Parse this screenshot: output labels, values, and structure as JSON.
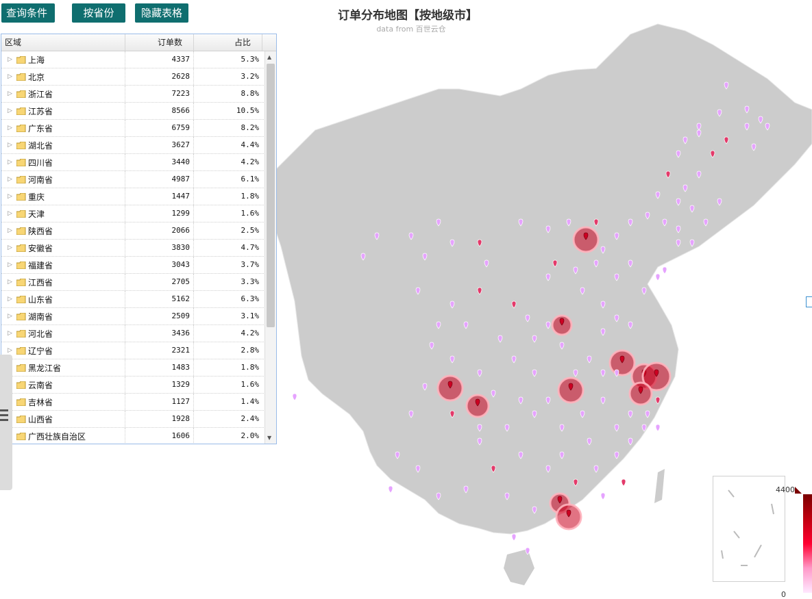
{
  "toolbar": {
    "query_label": "查询条件",
    "province_label": "按省份",
    "hide_label": "隐藏表格"
  },
  "map": {
    "title": "订单分布地图【按地级市】",
    "subtitle": "data from 百世云仓",
    "legend_max": "4400",
    "legend_min": "0",
    "colors": {
      "land": "#cccccc",
      "hot": "#cc0022",
      "cool": "#cc99ff",
      "accent": "#0f6e6f"
    }
  },
  "grid": {
    "columns": [
      "区域",
      "订单数",
      "占比"
    ],
    "rows": [
      {
        "name": "上海",
        "count": "4337",
        "ratio": "5.3%",
        "expandable": true
      },
      {
        "name": "北京",
        "count": "2628",
        "ratio": "3.2%",
        "expandable": true
      },
      {
        "name": "浙江省",
        "count": "7223",
        "ratio": "8.8%",
        "expandable": true
      },
      {
        "name": "江苏省",
        "count": "8566",
        "ratio": "10.5%",
        "expandable": true
      },
      {
        "name": "广东省",
        "count": "6759",
        "ratio": "8.2%",
        "expandable": true
      },
      {
        "name": "湖北省",
        "count": "3627",
        "ratio": "4.4%",
        "expandable": true
      },
      {
        "name": "四川省",
        "count": "3440",
        "ratio": "4.2%",
        "expandable": true
      },
      {
        "name": "河南省",
        "count": "4987",
        "ratio": "6.1%",
        "expandable": true
      },
      {
        "name": "重庆",
        "count": "1447",
        "ratio": "1.8%",
        "expandable": true
      },
      {
        "name": "天津",
        "count": "1299",
        "ratio": "1.6%",
        "expandable": true
      },
      {
        "name": "陕西省",
        "count": "2066",
        "ratio": "2.5%",
        "expandable": true
      },
      {
        "name": "安徽省",
        "count": "3830",
        "ratio": "4.7%",
        "expandable": true
      },
      {
        "name": "福建省",
        "count": "3043",
        "ratio": "3.7%",
        "expandable": true
      },
      {
        "name": "江西省",
        "count": "2705",
        "ratio": "3.3%",
        "expandable": true
      },
      {
        "name": "山东省",
        "count": "5162",
        "ratio": "6.3%",
        "expandable": true
      },
      {
        "name": "湖南省",
        "count": "2509",
        "ratio": "3.1%",
        "expandable": true
      },
      {
        "name": "河北省",
        "count": "3436",
        "ratio": "4.2%",
        "expandable": true
      },
      {
        "name": "辽宁省",
        "count": "2321",
        "ratio": "2.8%",
        "expandable": true
      },
      {
        "name": "黑龙江省",
        "count": "1483",
        "ratio": "1.8%",
        "expandable": false
      },
      {
        "name": "云南省",
        "count": "1329",
        "ratio": "1.6%",
        "expandable": false
      },
      {
        "name": "吉林省",
        "count": "1127",
        "ratio": "1.4%",
        "expandable": false
      },
      {
        "name": "山西省",
        "count": "1928",
        "ratio": "2.4%",
        "expandable": false
      },
      {
        "name": "广西壮族自治区",
        "count": "1606",
        "ratio": "2.0%",
        "expandable": false
      }
    ]
  }
}
